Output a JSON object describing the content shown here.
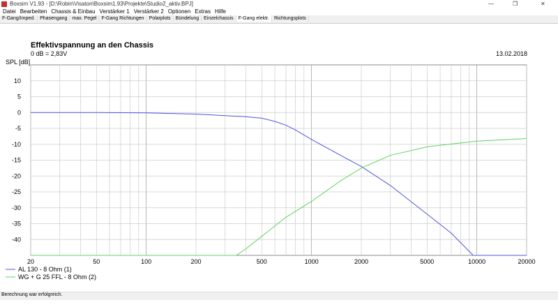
{
  "window": {
    "title": "Boxsim V1.93 - [D:\\Robin\\Visaton\\Boxsim1.93\\Projekte\\Studio2_aktiv.BPJ]",
    "controls": [
      "—",
      "❐",
      "✕"
    ]
  },
  "menu": [
    "Datei",
    "Bearbeiten",
    "Chassis & Einbau",
    "Verstärker 1",
    "Verstärker 2",
    "Optionen",
    "Extras",
    "Hilfe"
  ],
  "tabs": [
    "F-Gang/Imped.",
    "Phasengang",
    "max. Pegel",
    "F-Gang Richtungen",
    "Polarplots",
    "Bündelung",
    "Einzelchassis",
    "F-Gang elektr.",
    "Richtungsplots"
  ],
  "active_tab": 7,
  "status": "Berechnung war erfolgreich.",
  "chart_data": {
    "type": "line",
    "title": "Effektivspannung an den Chassis",
    "subtitle": "0 dB = 2,83V",
    "date": "13.02.2018",
    "ylabel": "SPL [dB]",
    "xscale": "log",
    "xlim": [
      20,
      20000
    ],
    "ylim": [
      -45,
      15
    ],
    "xticks": [
      20,
      50,
      100,
      200,
      500,
      1000,
      2000,
      5000,
      10000,
      20000
    ],
    "yticks": [
      10,
      5,
      0,
      -5,
      -10,
      -15,
      -20,
      -25,
      -30,
      -35,
      -40
    ],
    "grid": true,
    "legend": "bottom-left",
    "series": [
      {
        "name": "AL 130 - 8 Ohm (1)",
        "color": "#5050e0",
        "x": [
          20,
          50,
          100,
          200,
          300,
          400,
          500,
          600,
          700,
          800,
          1000,
          1500,
          2000,
          3000,
          5000,
          7000,
          9500,
          20000
        ],
        "y": [
          0,
          0,
          -0.1,
          -0.5,
          -1,
          -1.3,
          -1.8,
          -2.8,
          -4,
          -5.5,
          -8.5,
          -13.5,
          -17,
          -23,
          -32,
          -38,
          -45,
          -45
        ]
      },
      {
        "name": "WG + G 25 FFL - 8 Ohm (2)",
        "color": "#60d060",
        "x": [
          20,
          100,
          350,
          400,
          500,
          700,
          1000,
          1500,
          2000,
          3000,
          5000,
          10000,
          20000
        ],
        "y": [
          -45,
          -45,
          -45,
          -43,
          -39,
          -33,
          -28,
          -21.5,
          -17.5,
          -13.5,
          -10.8,
          -9,
          -8.2
        ]
      }
    ]
  }
}
